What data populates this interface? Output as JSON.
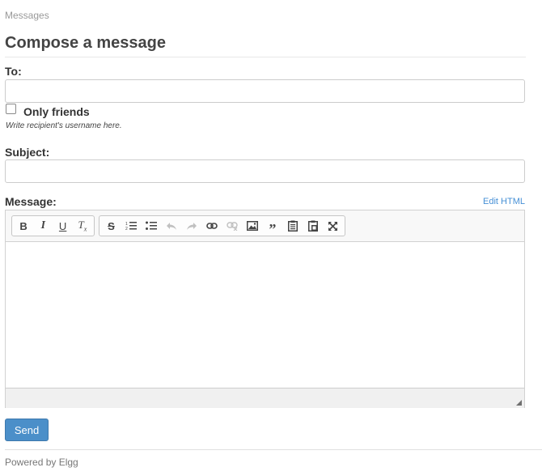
{
  "breadcrumb": "Messages",
  "page_title": "Compose a message",
  "form": {
    "to_label": "To:",
    "to_value": "",
    "only_friends_label": "Only friends",
    "only_friends_checked": false,
    "to_help": "Write recipient's username here.",
    "subject_label": "Subject:",
    "subject_value": "",
    "message_label": "Message:",
    "edit_html_link": "Edit HTML",
    "send_button": "Send"
  },
  "editor": {
    "toolbar_groups": [
      {
        "name": "basic-styles",
        "buttons": [
          {
            "icon": "bold-icon",
            "glyph": "B",
            "enabled": true
          },
          {
            "icon": "italic-icon",
            "glyph": "I",
            "enabled": true
          },
          {
            "icon": "underline-icon",
            "glyph": "U",
            "enabled": true
          },
          {
            "icon": "remove-format-icon",
            "glyph": "Tx",
            "enabled": true
          }
        ]
      },
      {
        "name": "tools",
        "buttons": [
          {
            "icon": "strikethrough-icon",
            "enabled": true
          },
          {
            "icon": "numbered-list-icon",
            "enabled": true
          },
          {
            "icon": "bulleted-list-icon",
            "enabled": true
          },
          {
            "icon": "undo-icon",
            "enabled": false
          },
          {
            "icon": "redo-icon",
            "enabled": false
          },
          {
            "icon": "link-icon",
            "enabled": true
          },
          {
            "icon": "unlink-icon",
            "enabled": false
          },
          {
            "icon": "image-icon",
            "enabled": true
          },
          {
            "icon": "blockquote-icon",
            "enabled": true
          },
          {
            "icon": "paste-icon",
            "enabled": true
          },
          {
            "icon": "paste-from-word-icon",
            "enabled": true
          },
          {
            "icon": "maximize-icon",
            "enabled": true
          }
        ]
      }
    ],
    "content": ""
  },
  "footer": "Powered by Elgg"
}
